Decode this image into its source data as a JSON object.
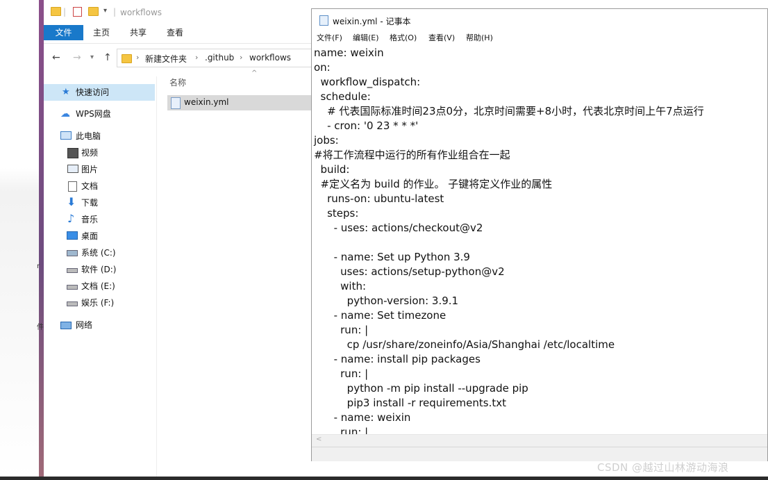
{
  "explorer": {
    "title": "workflows",
    "ribbon_tabs": [
      "文件",
      "主页",
      "共享",
      "查看"
    ],
    "breadcrumb": [
      "新建文件夹",
      ".github",
      "workflows"
    ],
    "column_header": "名称",
    "nav_items": [
      {
        "label": "快速访问",
        "icon": "star-icon"
      },
      {
        "label": "WPS网盘",
        "icon": "cloud-icon"
      },
      {
        "label": "此电脑",
        "icon": "computer-icon"
      },
      {
        "label": "视频",
        "icon": "video-icon"
      },
      {
        "label": "图片",
        "icon": "picture-icon"
      },
      {
        "label": "文档",
        "icon": "document-icon"
      },
      {
        "label": "下载",
        "icon": "download-icon"
      },
      {
        "label": "音乐",
        "icon": "music-icon"
      },
      {
        "label": "桌面",
        "icon": "desktop-icon"
      },
      {
        "label": "系统 (C:)",
        "icon": "drive-icon"
      },
      {
        "label": "软件 (D:)",
        "icon": "drive-icon"
      },
      {
        "label": "文档 (E:)",
        "icon": "drive-icon"
      },
      {
        "label": "娱乐 (F:)",
        "icon": "drive-icon"
      },
      {
        "label": "网络",
        "icon": "network-icon"
      }
    ],
    "files": [
      {
        "name": "weixin.yml"
      }
    ]
  },
  "notepad": {
    "title": "weixin.yml - 记事本",
    "menu": [
      "文件(F)",
      "编辑(E)",
      "格式(O)",
      "查看(V)",
      "帮助(H)"
    ],
    "lines": [
      "name: weixin",
      "on:",
      "  workflow_dispatch:",
      "  schedule:",
      "    # 代表国际标准时间23点0分，北京时间需要+8小时，代表北京时间上午7点运行",
      "    - cron: '0 23 * * *'",
      "jobs:",
      "#将工作流程中运行的所有作业组合在一起",
      "  build:",
      "  #定义名为 build 的作业。 子键将定义作业的属性",
      "    runs-on: ubuntu-latest",
      "    steps:",
      "      - uses: actions/checkout@v2",
      "",
      "      - name: Set up Python 3.9",
      "        uses: actions/setup-python@v2",
      "        with:",
      "          python-version: 3.9.1",
      "      - name: Set timezone",
      "        run: |",
      "          cp /usr/share/zoneinfo/Asia/Shanghai /etc/localtime",
      "      - name: install pip packages",
      "        run: |",
      "          python -m pip install --upgrade pip",
      "          pip3 install -r requirements.txt",
      "      - name: weixin",
      "        run: |"
    ]
  },
  "watermark": "CSDN @越过山林游动海浪",
  "desktop_glyphs": [
    "r",
    "件"
  ],
  "colors": {
    "ribbon_file": "#1979ca",
    "selection": "#cde6f7",
    "desktop_bar": "#7a4d80"
  }
}
